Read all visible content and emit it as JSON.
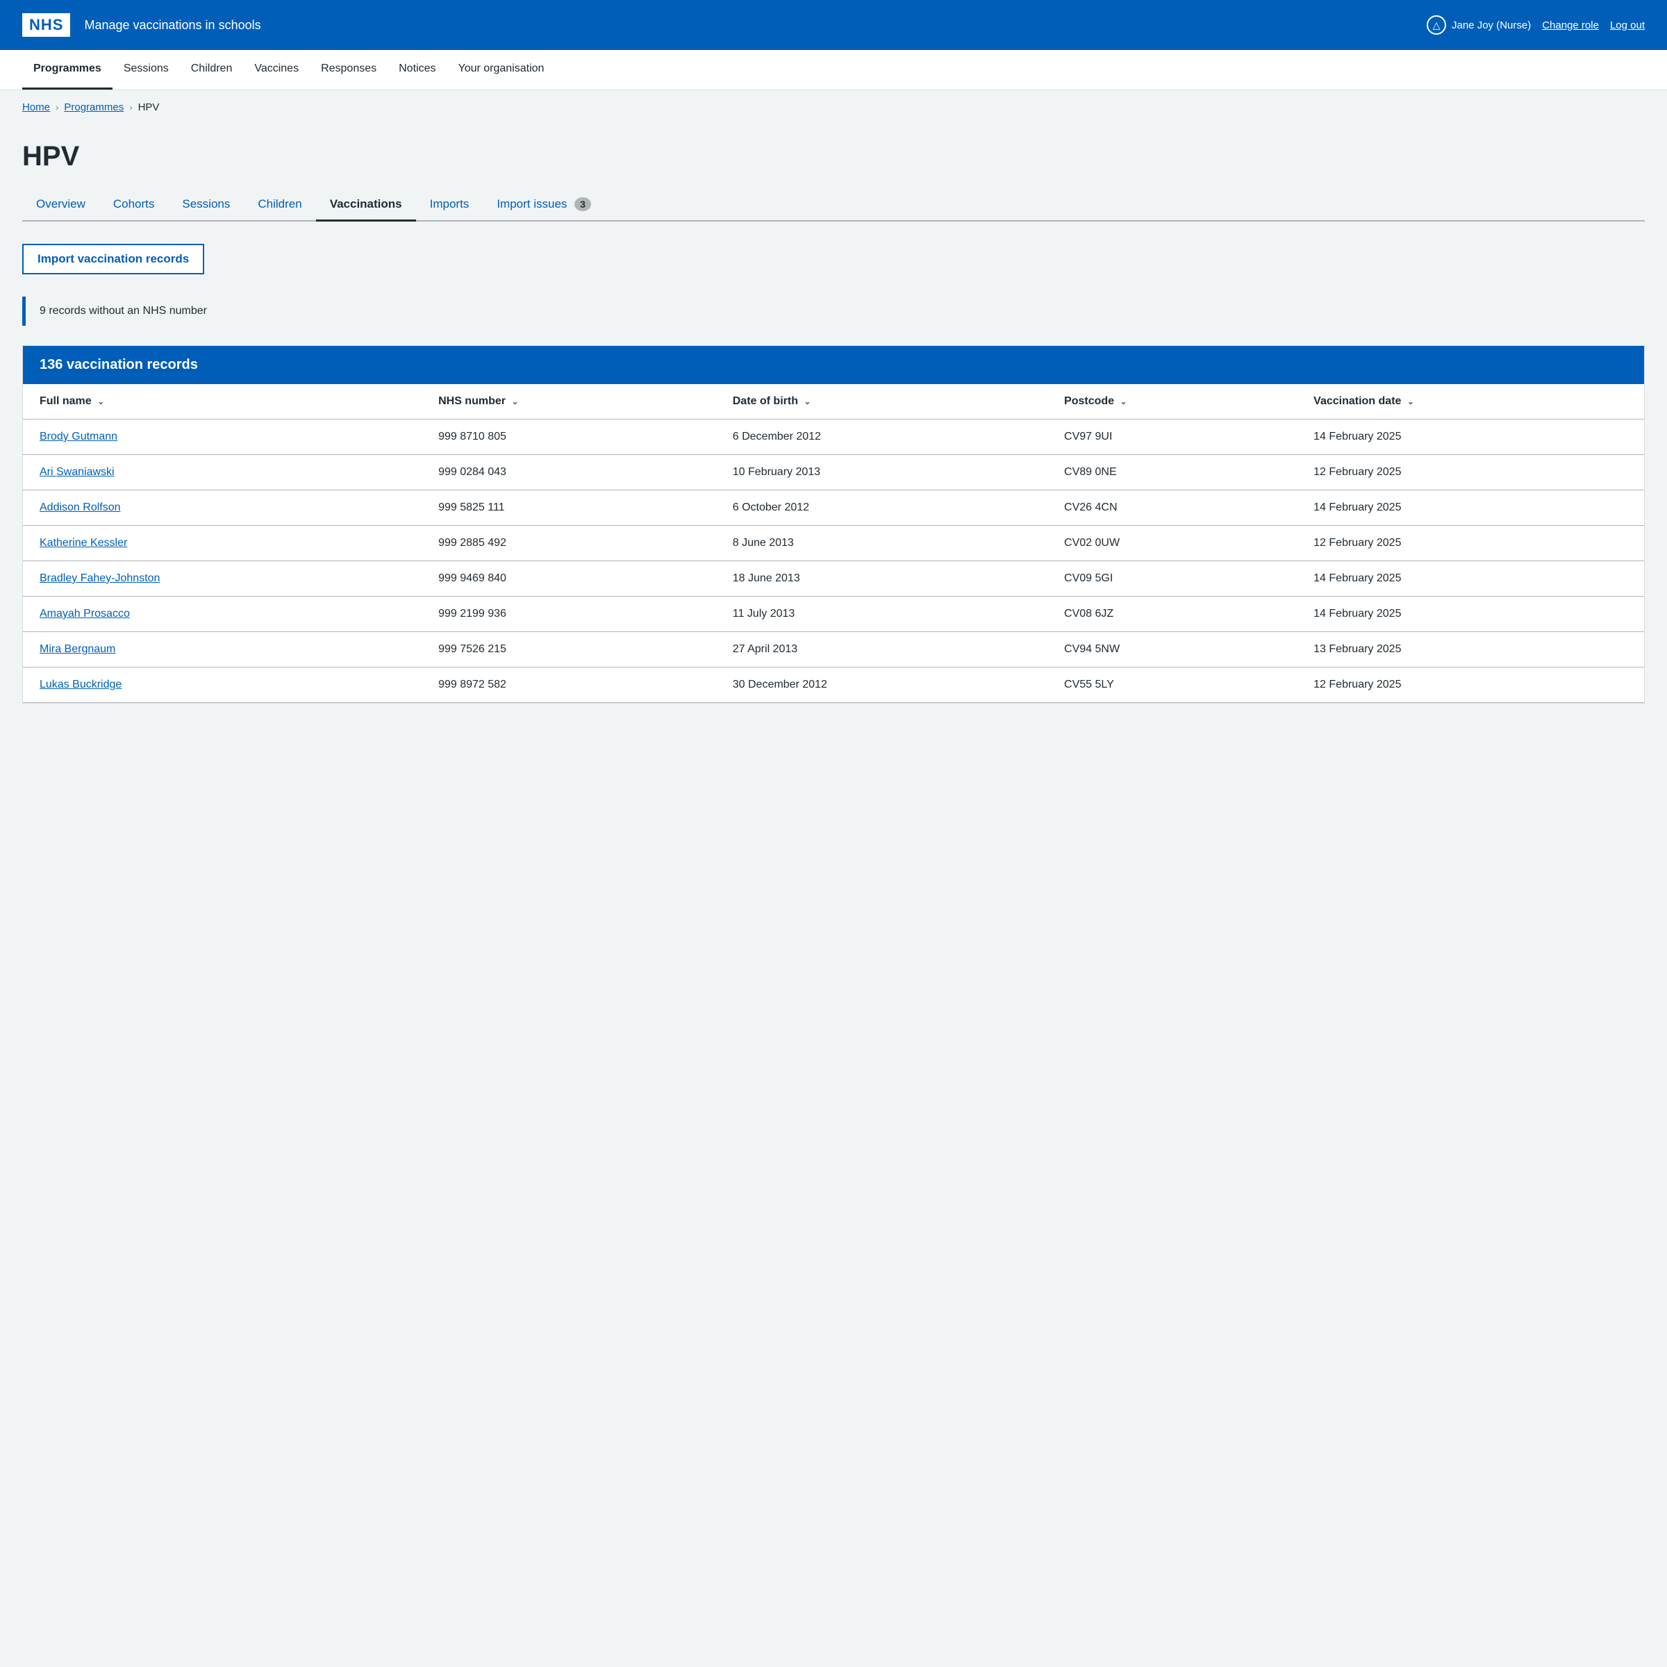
{
  "header": {
    "logo": "NHS",
    "title": "Manage vaccinations in schools",
    "user": "Jane Joy (Nurse)",
    "change_role": "Change role",
    "log_out": "Log out"
  },
  "nav": {
    "items": [
      {
        "label": "Programmes",
        "active": true
      },
      {
        "label": "Sessions",
        "active": false
      },
      {
        "label": "Children",
        "active": false
      },
      {
        "label": "Vaccines",
        "active": false
      },
      {
        "label": "Responses",
        "active": false
      },
      {
        "label": "Notices",
        "active": false
      },
      {
        "label": "Your organisation",
        "active": false
      }
    ]
  },
  "breadcrumb": {
    "items": [
      "Home",
      "Programmes",
      "HPV"
    ]
  },
  "page": {
    "title": "HPV"
  },
  "tabs": {
    "items": [
      {
        "label": "Overview",
        "active": false
      },
      {
        "label": "Cohorts",
        "active": false
      },
      {
        "label": "Sessions",
        "active": false
      },
      {
        "label": "Children",
        "active": false
      },
      {
        "label": "Vaccinations",
        "active": true
      },
      {
        "label": "Imports",
        "active": false
      },
      {
        "label": "Import issues",
        "active": false,
        "badge": "3"
      }
    ]
  },
  "import_button": "Import vaccination records",
  "warning": "9 records without an NHS number",
  "records_title": "136 vaccination records",
  "table": {
    "columns": [
      "Full name",
      "NHS number",
      "Date of birth",
      "Postcode",
      "Vaccination date"
    ],
    "rows": [
      {
        "name": "Brody Gutmann",
        "nhs": "999  8710  805",
        "dob": "6 December 2012",
        "postcode": "CV97 9UI",
        "vax_date": "14 February 2025"
      },
      {
        "name": "Ari Swaniawski",
        "nhs": "999  0284  043",
        "dob": "10 February 2013",
        "postcode": "CV89 0NE",
        "vax_date": "12 February 2025"
      },
      {
        "name": "Addison Rolfson",
        "nhs": "999  5825  111",
        "dob": "6 October 2012",
        "postcode": "CV26 4CN",
        "vax_date": "14 February 2025"
      },
      {
        "name": "Katherine Kessler",
        "nhs": "999  2885  492",
        "dob": "8 June 2013",
        "postcode": "CV02 0UW",
        "vax_date": "12 February 2025"
      },
      {
        "name": "Bradley Fahey-Johnston",
        "nhs": "999  9469  840",
        "dob": "18 June 2013",
        "postcode": "CV09 5GI",
        "vax_date": "14 February 2025"
      },
      {
        "name": "Amayah Prosacco",
        "nhs": "999  2199  936",
        "dob": "11 July 2013",
        "postcode": "CV08 6JZ",
        "vax_date": "14 February 2025"
      },
      {
        "name": "Mira Bergnaum",
        "nhs": "999  7526  215",
        "dob": "27 April 2013",
        "postcode": "CV94 5NW",
        "vax_date": "13 February 2025"
      },
      {
        "name": "Lukas Buckridge",
        "nhs": "999  8972  582",
        "dob": "30 December 2012",
        "postcode": "CV55 5LY",
        "vax_date": "12 February 2025"
      }
    ]
  }
}
